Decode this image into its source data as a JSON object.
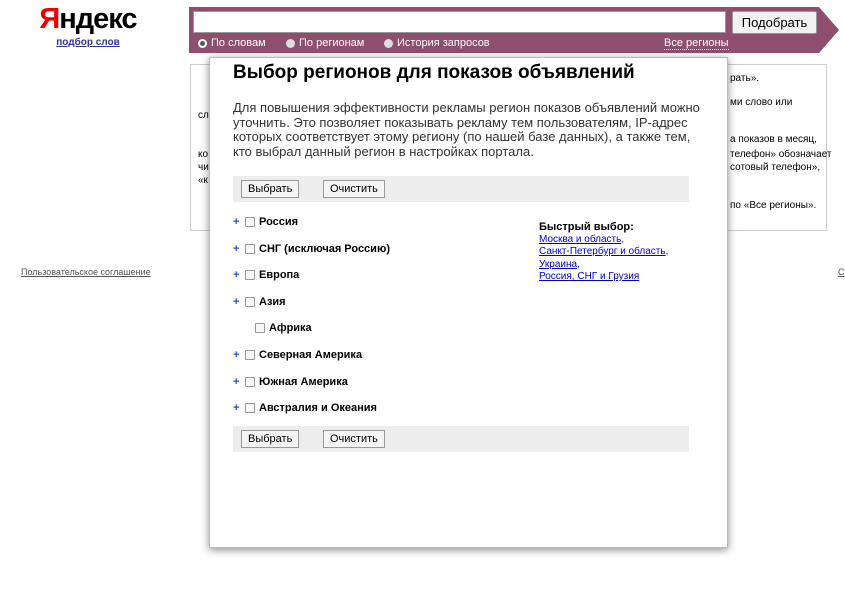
{
  "logo": {
    "brand": "Яндекс",
    "subtitle": "подбор слов"
  },
  "search": {
    "value": "",
    "button_label": "Подобрать"
  },
  "modes": [
    {
      "label": "По словам",
      "selected": true
    },
    {
      "label": "По регионам",
      "selected": false
    },
    {
      "label": "История запросов",
      "selected": false
    }
  ],
  "all_regions_link": "Все регионы",
  "background_fragments": [
    "рать».",
    "ми слово или",
    "сл",
    "а показов в месяц,",
    "ко",
    "телефон» обозначает",
    "чи",
    "сотовый телефон»,",
    "«к",
    "по «Все регионы»."
  ],
  "footer": {
    "agreement_link": "Пользовательское соглашение",
    "right_link": "С"
  },
  "modal": {
    "title": "Выбор регионов для показов объявлений",
    "description": "Для повышения эффективности рекламы регион показов объявлений можно уточнить. Это позволяет показывать рекламу тем пользователям, IP-адрес которых соответствует этому региону (по нашей базе данных), а также тем, кто выбрал данный регион в настройках портала.",
    "select_label": "Выбрать",
    "clear_label": "Очистить",
    "regions": [
      {
        "label": "Россия",
        "expandable": true
      },
      {
        "label": "СНГ (исключая Россию)",
        "expandable": true
      },
      {
        "label": "Европа",
        "expandable": true
      },
      {
        "label": "Азия",
        "expandable": true
      },
      {
        "label": "Африка",
        "expandable": false
      },
      {
        "label": "Северная Америка",
        "expandable": true
      },
      {
        "label": "Южная Америка",
        "expandable": true
      },
      {
        "label": "Австралия и Океания",
        "expandable": true
      }
    ],
    "quick_select": {
      "title": "Быстрый выбор:",
      "links": [
        "Москва и область",
        "Санкт-Петербург и область",
        "Украина",
        "Россия, СНГ и Грузия"
      ]
    }
  },
  "colors": {
    "bar": "#8f4e6d",
    "link": "#0000cc",
    "expand": "#2a4fd6"
  }
}
